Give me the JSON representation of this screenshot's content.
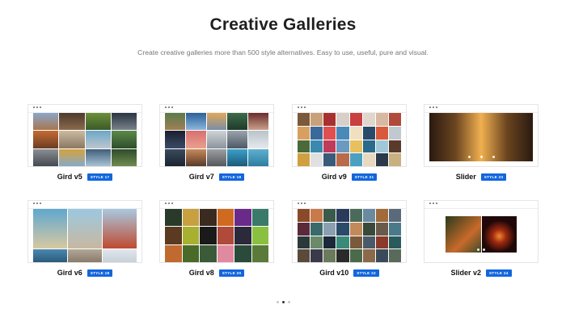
{
  "header": {
    "title": "Creative Galleries",
    "subtitle": "Create creative galleries more than 500 style alternatives. Easy to use, useful, pure and visual."
  },
  "cards": [
    {
      "name": "Gird v5",
      "badge": "STYLE 17"
    },
    {
      "name": "Gird v7",
      "badge": "STYLE 19"
    },
    {
      "name": "Gird v9",
      "badge": "STYLE 21"
    },
    {
      "name": "Slider",
      "badge": "STYLE 23"
    },
    {
      "name": "Gird v6",
      "badge": "STYLE 18"
    },
    {
      "name": "Gird v8",
      "badge": "STYLE 20"
    },
    {
      "name": "Gird v10",
      "badge": "STYLE 22"
    },
    {
      "name": "Slider v2",
      "badge": "STYLE 24"
    }
  ],
  "pager": {
    "active_index": 1,
    "count": 3
  },
  "colors": {
    "badge": "#1166dd",
    "text": "#1f1f1f",
    "subtitle": "#777777"
  }
}
